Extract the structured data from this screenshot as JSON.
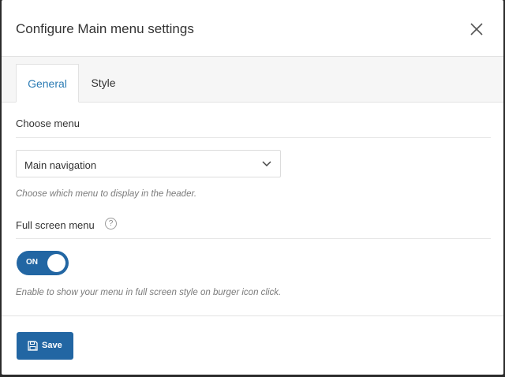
{
  "dialog": {
    "title": "Configure Main menu settings",
    "close_icon": "close-icon"
  },
  "tabs": [
    {
      "label": "General",
      "active": true
    },
    {
      "label": "Style",
      "active": false
    }
  ],
  "choose_menu": {
    "label": "Choose menu",
    "selected": "Main navigation",
    "chevron_icon": "chevron-down-icon",
    "help": "Choose which menu to display in the header."
  },
  "full_screen_menu": {
    "label": "Full screen menu",
    "help_icon_glyph": "?",
    "toggle_label": "ON",
    "toggle_state": true,
    "help": "Enable to show your menu in full screen style on burger icon click."
  },
  "footer": {
    "save_label": "Save",
    "save_icon": "floppy-disk-icon"
  },
  "colors": {
    "accent": "#2266a3",
    "active_tab_text": "#2b7bb4"
  }
}
